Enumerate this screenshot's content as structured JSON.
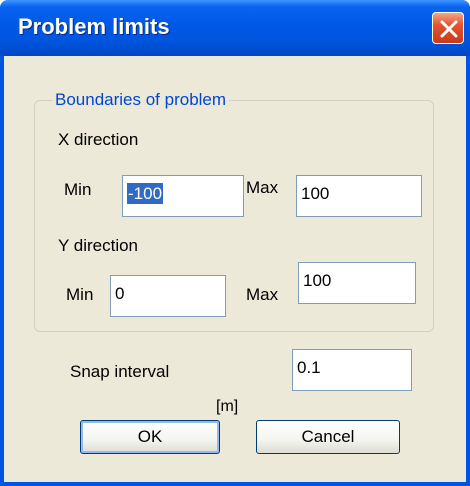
{
  "window": {
    "title": "Problem limits"
  },
  "group": {
    "title": "Boundaries of problem"
  },
  "x_direction": {
    "label": "X direction",
    "min_label": "Min",
    "min_value": "-100",
    "max_label": "Max",
    "max_value": "100"
  },
  "y_direction": {
    "label": "Y direction",
    "min_label": "Min",
    "min_value": "0",
    "max_label": "Max",
    "max_value": "100"
  },
  "snap": {
    "label": "Snap interval",
    "unit": "[m]",
    "value": "0.1"
  },
  "buttons": {
    "ok": "OK",
    "cancel": "Cancel"
  },
  "colors": {
    "titlebar": "#0058e6",
    "face": "#ece9d8",
    "group_title": "#0046d5",
    "selection": "#316ac5",
    "close": "#e2552e"
  },
  "icons": {
    "close": "close-icon"
  }
}
